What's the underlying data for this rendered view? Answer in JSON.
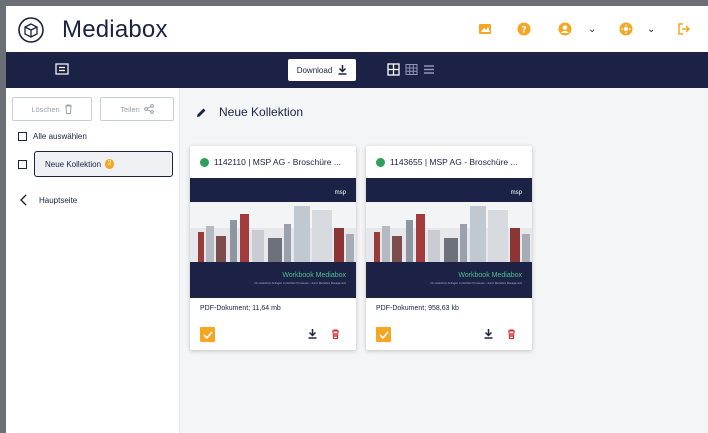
{
  "app": {
    "title": "Mediabox"
  },
  "header": {
    "icons": [
      "image-icon",
      "help-icon",
      "user-icon",
      "chevron-down-icon",
      "settings-icon",
      "chevron-down-icon",
      "logout-icon"
    ],
    "accent": "#f5a623"
  },
  "toolbar": {
    "download_label": "Download",
    "views": [
      "large-grid-icon",
      "small-grid-icon",
      "list-icon"
    ],
    "background": "#1b2245"
  },
  "sidebar": {
    "delete_label": "Löschen",
    "share_label": "Teilen",
    "select_all_label": "Alle auswählen",
    "collection": {
      "label": "Neue Kollektion",
      "count": "2"
    },
    "back_label": "Hauptseite"
  },
  "main": {
    "title": "Neue Kollektion",
    "cards": [
      {
        "title": "1142110 | MSP AG - Broschüre ...",
        "meta": "PDF-Dokument; 11,64 mb",
        "thumb_brand": "msp",
        "thumb_title": "Workbook Mediabox",
        "thumb_subtitle": "Von statischen Anfragen zu flexiblen Prozessen – durch Mediabox Management",
        "checked": true
      },
      {
        "title": "1143655 | MSP AG - Broschüre ...",
        "meta": "PDF-Dokument; 958,63 kb",
        "thumb_brand": "msp",
        "thumb_title": "Workbook Mediabox",
        "thumb_subtitle": "Von statischen Anfragen zu flexiblen Prozessen – durch Mediabox Management",
        "checked": true
      }
    ]
  }
}
